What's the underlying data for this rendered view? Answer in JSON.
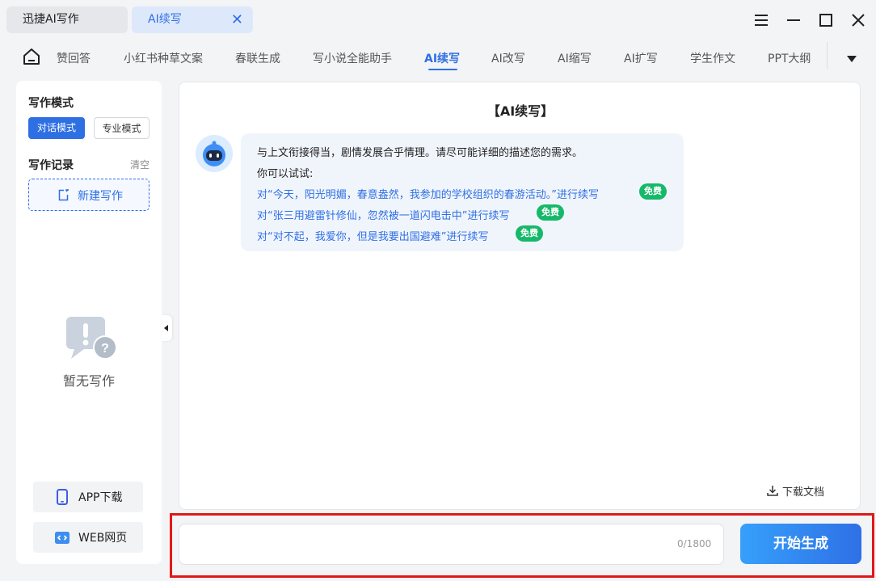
{
  "window": {
    "tabs": [
      {
        "label": "迅捷AI写作"
      },
      {
        "label": "AI续写"
      }
    ],
    "close_tab_glyph": "✕"
  },
  "nav": {
    "items": [
      {
        "label": "赞回答"
      },
      {
        "label": "小红书种草文案"
      },
      {
        "label": "春联生成"
      },
      {
        "label": "写小说全能助手"
      },
      {
        "label": "AI续写"
      },
      {
        "label": "AI改写"
      },
      {
        "label": "AI缩写"
      },
      {
        "label": "AI扩写"
      },
      {
        "label": "学生作文"
      },
      {
        "label": "PPT大纲"
      }
    ],
    "active_index": 4
  },
  "sidebar": {
    "mode_title": "写作模式",
    "modes": [
      {
        "label": "对话模式",
        "selected": true
      },
      {
        "label": "专业模式",
        "selected": false
      }
    ],
    "records_title": "写作记录",
    "clear_label": "清空",
    "new_label": "新建写作",
    "empty_text": "暂无写作",
    "app_label": "APP下载",
    "web_label": "WEB网页"
  },
  "chat": {
    "title": "【AI续写】",
    "intro": "与上文衔接得当，剧情发展合乎情理。请尽可能详细的描述您的需求。",
    "try_label": "你可以试试:",
    "suggestions": [
      {
        "text": "对“今天，阳光明媚，春意盎然，我参加的学校组织的春游活动。”进行续写",
        "badge": "免费"
      },
      {
        "text": "对“张三用避雷针修仙，忽然被一道闪电击中”进行续写",
        "badge": "免费"
      },
      {
        "text": "对“对不起，我爱你，但是我要出国避难”进行续写",
        "badge": "免费"
      }
    ],
    "download_label": "下载文档"
  },
  "input": {
    "value": "",
    "placeholder": "",
    "counter": "0/1800",
    "generate_label": "开始生成"
  },
  "colors": {
    "accent": "#2f6fe4",
    "badge": "#16b86a",
    "highlight_border": "#e01818"
  }
}
